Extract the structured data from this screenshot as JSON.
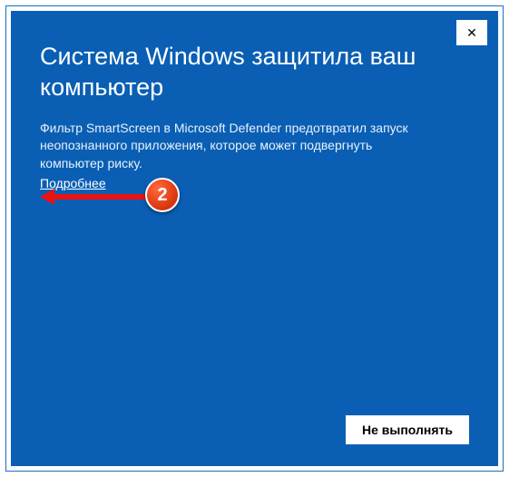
{
  "dialog": {
    "title": "Система Windows защитила ваш компьютер",
    "body": "Фильтр SmartScreen в Microsoft Defender предотвратил запуск неопознанного приложения, которое может подвергнуть компьютер риску.",
    "more_info_label": "Подробнее",
    "dont_run_label": "Не выполнять",
    "close_glyph": "✕"
  },
  "annotation": {
    "step_number": "2"
  }
}
